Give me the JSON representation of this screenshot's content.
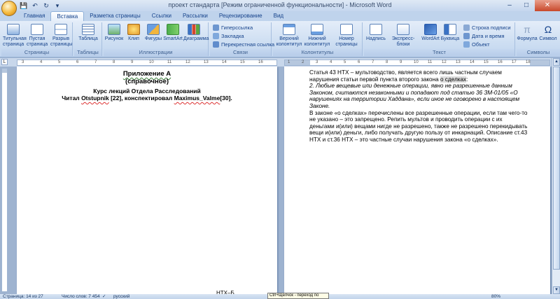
{
  "window": {
    "title": "проект стандарта [Режим ограниченной функциональности] - Microsoft Word",
    "controls": {
      "minimize": "–",
      "maximize": "□",
      "close": "✕"
    }
  },
  "quick_access": {
    "save": "💾",
    "undo": "↶",
    "redo": "↻",
    "more": "▾"
  },
  "tabs": [
    "Главная",
    "Вставка",
    "Разметка страницы",
    "Ссылки",
    "Рассылки",
    "Рецензирование",
    "Вид"
  ],
  "ribbon": {
    "groups": {
      "pages": {
        "label": "Страницы",
        "buttons": [
          "Титульная страница",
          "Пустая страница",
          "Разрыв страницы"
        ]
      },
      "tables": {
        "label": "Таблицы",
        "buttons": [
          "Таблица"
        ]
      },
      "illustrations": {
        "label": "Иллюстрации",
        "buttons": [
          "Рисунок",
          "Клип",
          "Фигуры",
          "SmartArt",
          "Диаграмма"
        ]
      },
      "links": {
        "label": "Связи",
        "buttons": [
          "Гиперссылка",
          "Закладка",
          "Перекрестная ссылка"
        ]
      },
      "headers": {
        "label": "Колонтитулы",
        "buttons": [
          "Верхний колонтитул",
          "Нижний колонтитул",
          "Номер страницы"
        ]
      },
      "text": {
        "label": "Текст",
        "buttons": [
          "Надпись",
          "Экспресс-блоки",
          "WordArt",
          "Буквица"
        ],
        "small": [
          "Строка подписи",
          "Дата и время",
          "Объект"
        ]
      },
      "symbols": {
        "label": "Символы",
        "buttons": [
          "Формула",
          "Символ"
        ]
      }
    }
  },
  "ruler": {
    "corner": "L",
    "ticks_p1": [
      "3",
      "4",
      "5",
      "6",
      "7",
      "8",
      "9",
      "10",
      "11",
      "12",
      "13",
      "14",
      "15",
      "16"
    ],
    "ticks_p2": [
      "1",
      "2",
      "3",
      "4",
      "5",
      "6",
      "7",
      "8",
      "9",
      "10",
      "11",
      "12",
      "13",
      "14",
      "15",
      "16",
      "17",
      "18"
    ]
  },
  "page1": {
    "title": "Приложение А",
    "subtitle": "(справочное)",
    "line3": "Курс лекций Отдела Расследований",
    "line4_a": "Читал ",
    "line4_name1": "Otstupnik",
    "line4_b": " [22], конспектировал ",
    "line4_name2": "Maximus_Valme",
    "line4_c": "[30].",
    "footer": "НТХ–Б"
  },
  "page2": {
    "para1": "Статья 43 НТХ – мультоводство, является всего лишь частным случаем нарушения статьи первой пункта второго закона ",
    "para1_hl": "о сделках",
    "para1_end": ":",
    "para2": "2. Любые вещевые или денежные операции, явно не разрешенные данным Законом, считаются незаконными и попадают под статью 36 ЗМ-01/05 «О нарушениях на территории Хаддана», если иное не оговорено в настоящем Законе.",
    "para3": "В законе «о сделках» перечислены все разрешенные операции, если там чего-то не указано – это запрещено. Репить мультов и проводить операции с их деньгами и(или) вещами нигде не разрешено, также не разрешено перекидывать вещи и(или) деньги, либо получать другую пользу от инкарнаций. Описание ст.43 НТХ и ст.36 НТХ – это частные случаи нарушения закона «о сделках»."
  },
  "status": {
    "page": "Страница: 14 из 27",
    "words": "Число слов: 7 454",
    "language": "русский",
    "zoom": "80%",
    "tooltip": "Ctrl+Щелчок - переход по ссылке"
  },
  "colors": {
    "ribbon": "#dae6f6",
    "accent": "#15428b",
    "close": "#c8482a"
  }
}
